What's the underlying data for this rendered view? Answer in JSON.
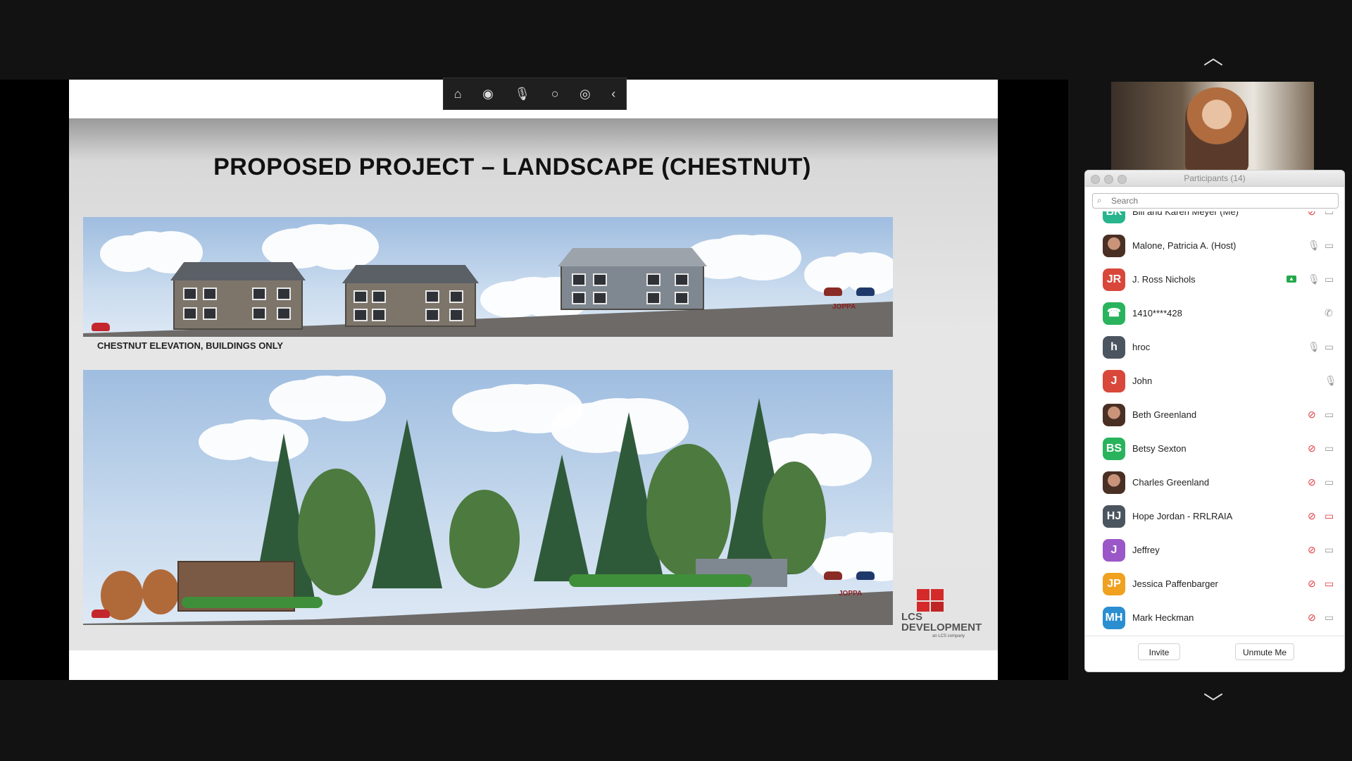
{
  "slide": {
    "title": "PROPOSED PROJECT – LANDSCAPE (CHESTNUT)",
    "panel1_caption": "CHESTNUT ELEVATION, BUILDINGS ONLY",
    "road_label_top": "JOPPA",
    "road_label_bottom": "JOPPA",
    "logo_line1": "LCS",
    "logo_line2": "DEVELOPMENT",
    "logo_sub": "an LCS company"
  },
  "share_toolbar": {
    "icons": [
      "brand-icon",
      "record-icon",
      "mic-icon",
      "circle-icon",
      "broadcast-icon",
      "collapse-icon"
    ]
  },
  "participants": {
    "title": "Participants (14)",
    "search_placeholder": "Search",
    "rows": [
      {
        "name": "Bill and Karen Meyer (Me)",
        "initials": "BK",
        "color": "#28b48c",
        "mic": "muted",
        "cam": "on"
      },
      {
        "name": "Malone, Patricia A. (Host)",
        "initials": "",
        "color": "#6a4a3a",
        "mic": "on",
        "cam": "on"
      },
      {
        "name": "J. Ross Nichols",
        "initials": "JR",
        "color": "#d9473a",
        "mic": "on",
        "cam": "on",
        "sharing": true
      },
      {
        "name": "1410****428",
        "initials": "☎",
        "color": "#29b35c",
        "mic": "none",
        "cam": "phone"
      },
      {
        "name": "hroc",
        "initials": "h",
        "color": "#4b5560",
        "mic": "on",
        "cam": "on"
      },
      {
        "name": "John",
        "initials": "J",
        "color": "#d9473a",
        "mic": "on",
        "cam": "none"
      },
      {
        "name": "Beth Greenland",
        "initials": "",
        "color": "#7a4a3a",
        "mic": "muted",
        "cam": "on"
      },
      {
        "name": "Betsy Sexton",
        "initials": "BS",
        "color": "#29b35c",
        "mic": "muted",
        "cam": "on"
      },
      {
        "name": "Charles Greenland",
        "initials": "",
        "color": "#9a8a80",
        "mic": "muted",
        "cam": "on"
      },
      {
        "name": "Hope Jordan - RRLRAIA",
        "initials": "HJ",
        "color": "#4b5560",
        "mic": "muted",
        "cam": "off"
      },
      {
        "name": "Jeffrey",
        "initials": "J",
        "color": "#9b57c8",
        "mic": "muted",
        "cam": "on"
      },
      {
        "name": "Jessica Paffenbarger",
        "initials": "JP",
        "color": "#f0a11f",
        "mic": "muted",
        "cam": "off"
      },
      {
        "name": "Mark Heckman",
        "initials": "MH",
        "color": "#2a8ed1",
        "mic": "muted",
        "cam": "on"
      }
    ],
    "invite_label": "Invite",
    "unmute_label": "Unmute Me"
  }
}
